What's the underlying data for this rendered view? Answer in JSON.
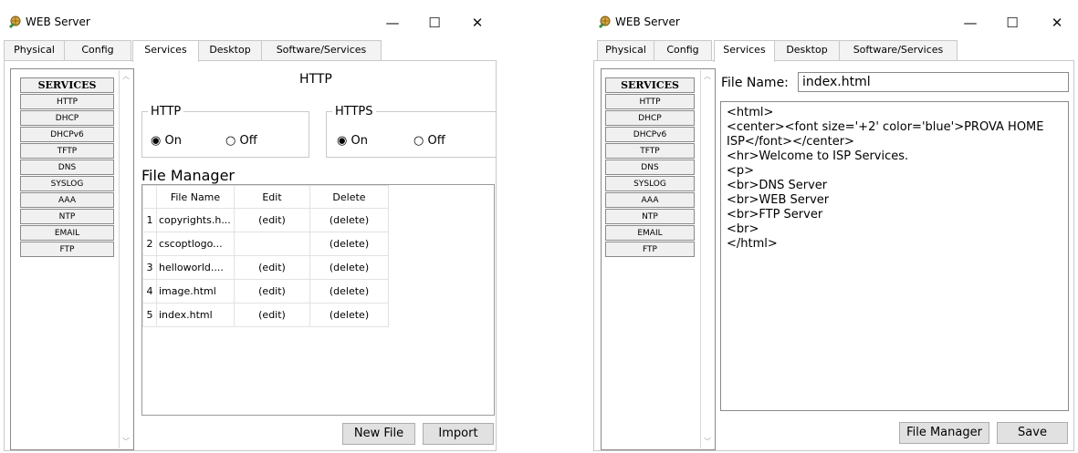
{
  "windows": {
    "left": {
      "title": "WEB Server",
      "controls": {
        "minimize": "—",
        "maximize": "☐",
        "close": "✕"
      },
      "tabs": [
        "Physical",
        "Config",
        "Services",
        "Desktop",
        "Software/Services"
      ],
      "services": [
        "SERVICES",
        "HTTP",
        "DHCP",
        "DHCPv6",
        "TFTP",
        "DNS",
        "SYSLOG",
        "AAA",
        "NTP",
        "EMAIL",
        "FTP"
      ],
      "panel_title": "HTTP",
      "http_group": {
        "legend": "HTTP",
        "on": "On",
        "off": "Off"
      },
      "https_group": {
        "legend": "HTTPS",
        "on": "On",
        "off": "Off"
      },
      "file_manager_title": "File Manager",
      "table": {
        "headers": [
          "",
          "File Name",
          "Edit",
          "Delete"
        ],
        "rows": [
          [
            "1",
            "copyrights.h...",
            "(edit)",
            "(delete)"
          ],
          [
            "2",
            "cscoptlogo...",
            "",
            "(delete)"
          ],
          [
            "3",
            "helloworld....",
            "(edit)",
            "(delete)"
          ],
          [
            "4",
            "image.html",
            "(edit)",
            "(delete)"
          ],
          [
            "5",
            "index.html",
            "(edit)",
            "(delete)"
          ]
        ]
      },
      "buttons": {
        "new_file": "New File",
        "import": "Import"
      }
    },
    "right": {
      "title": "WEB Server",
      "controls": {
        "minimize": "—",
        "maximize": "☐",
        "close": "✕"
      },
      "tabs": [
        "Physical",
        "Config",
        "Services",
        "Desktop",
        "Software/Services"
      ],
      "services": [
        "SERVICES",
        "HTTP",
        "DHCP",
        "DHCPv6",
        "TFTP",
        "DNS",
        "SYSLOG",
        "AAA",
        "NTP",
        "EMAIL",
        "FTP"
      ],
      "file_name_label": "File Name:",
      "file_name_value": "index.html",
      "editor_content": "<html>\n<center><font size='+2' color='blue'>PROVA HOME ISP</font></center>\n<hr>Welcome to ISP Services.\n<p>\n<br>DNS Server\n<br>WEB Server\n<br>FTP Server\n<br>\n</html>",
      "buttons": {
        "file_manager": "File Manager",
        "save": "Save"
      }
    }
  },
  "icons": {
    "app": "server-globe-icon",
    "scroll_up": "scroll-up-arrow-icon",
    "scroll_down": "scroll-down-arrow-icon"
  },
  "colors": {
    "button_bg": "#e1e1e1",
    "border": "#8a8a8a",
    "tab_bg": "#f3f3f3"
  }
}
